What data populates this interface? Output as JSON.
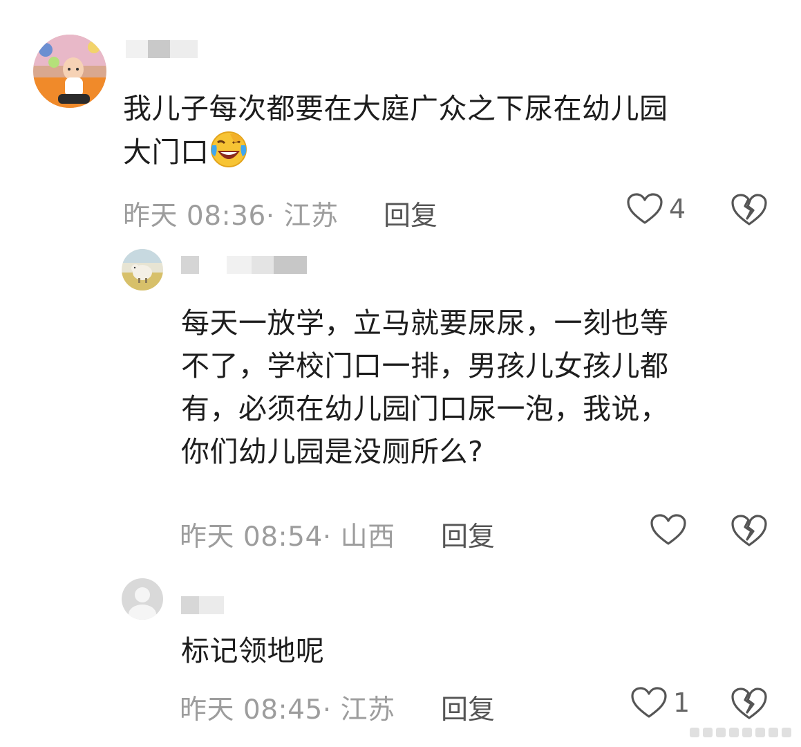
{
  "comments": [
    {
      "text_line1": "我儿子每次都要在大庭广众之下尿在幼儿园",
      "text_line2": "大门口",
      "emoji": "face-laughing-tears-icon",
      "time": "昨天 08:36· 江苏",
      "reply_label": "回复",
      "likes": "4"
    },
    {
      "text_line1": "每天一放学，立马就要尿尿，一刻也等",
      "text_line2": "不了，学校门口一排，男孩儿女孩儿都",
      "text_line3": "有，必须在幼儿园门口尿一泡，我说，",
      "text_line4": "你们幼儿园是没厕所么?",
      "time": "昨天 08:54· 山西",
      "reply_label": "回复",
      "likes": ""
    },
    {
      "text_line1": "标记领地呢",
      "time": "昨天 08:45· 江苏",
      "reply_label": "回复",
      "likes": "1"
    }
  ],
  "colors": {
    "text": "#1d1d1d",
    "meta": "#9d9d9d",
    "icon": "#555555"
  }
}
